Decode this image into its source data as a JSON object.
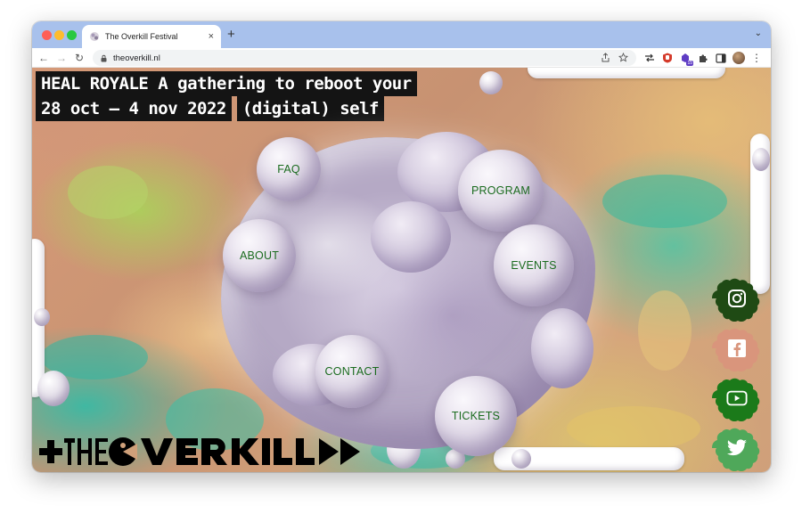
{
  "browser": {
    "tab_title": "The Overkill Festival",
    "tab_close": "×",
    "new_tab": "+",
    "tab_menu": "⌄",
    "back": "←",
    "forward": "→",
    "reload": "↻",
    "url": "theoverkill.nl",
    "ext_badge": "15",
    "menu": "⋮",
    "tab_color": "#a8c1ec"
  },
  "headline": {
    "line1": "HEAL ROYALE A gathering to reboot your",
    "line2_dates": "28 oct — 4 nov 2022",
    "line2_rest": "(digital) self"
  },
  "nav": {
    "faq": "FAQ",
    "program": "PROGRAM",
    "about": "ABOUT",
    "events": "EVENTS",
    "contact": "CONTACT",
    "tickets": "TICKETS",
    "text_color": "#1a6b1e"
  },
  "social": {
    "instagram_color": "#1f4a14",
    "facebook_color": "#d9957c",
    "youtube_color": "#1b7a1a",
    "twitter_color": "#4fa85a",
    "icons": [
      "instagram-icon",
      "facebook-icon",
      "youtube-icon",
      "twitter-icon"
    ]
  },
  "logo": {
    "alt": "THE OVERKILL"
  }
}
